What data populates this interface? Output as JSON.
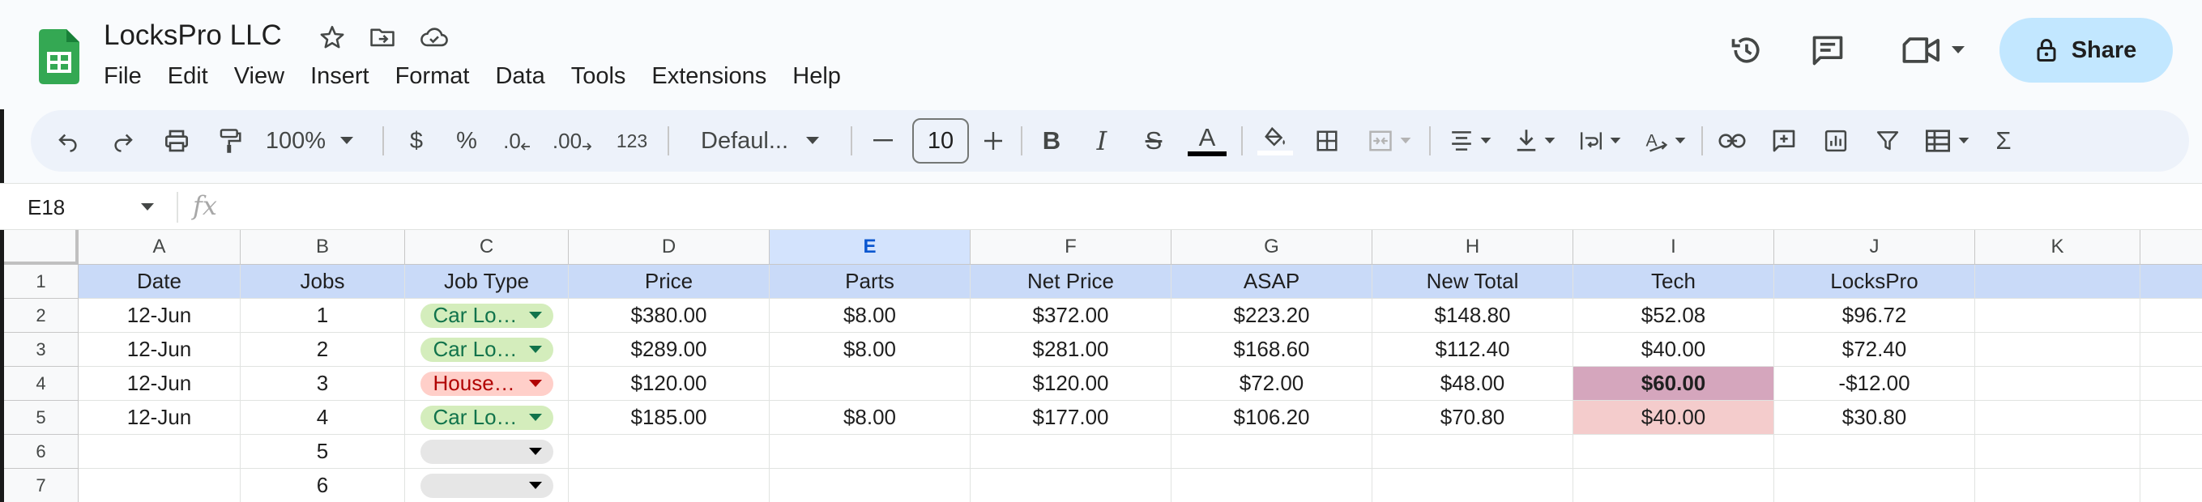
{
  "app": {
    "doc_title": "LocksPro LLC",
    "menu": [
      "File",
      "Edit",
      "View",
      "Insert",
      "Format",
      "Data",
      "Tools",
      "Extensions",
      "Help"
    ],
    "share_label": "Share"
  },
  "toolbar": {
    "zoom": "100%",
    "currency": "$",
    "percent": "%",
    "decrease_decimal": ".0",
    "increase_decimal": ".00",
    "more_formats": "123",
    "font": "Defaul...",
    "font_size": "10"
  },
  "formula_bar": {
    "cell_ref": "E18",
    "fx": "fx"
  },
  "grid": {
    "columns": [
      "A",
      "B",
      "C",
      "D",
      "E",
      "F",
      "G",
      "H",
      "I",
      "J",
      "K"
    ],
    "selected_column": "E",
    "row_numbers": [
      "1",
      "2",
      "3",
      "4",
      "5",
      "6",
      "7"
    ],
    "header_row": [
      "Date",
      "Jobs",
      "Job Type",
      "Price",
      "Parts",
      "Net Price",
      "ASAP",
      "New Total",
      "Tech",
      "LocksPro",
      ""
    ],
    "rows": [
      [
        "12-Jun",
        "1",
        "Car Lo…",
        "$380.00",
        "$8.00",
        "$372.00",
        "$223.20",
        "$148.80",
        "$52.08",
        "$96.72",
        ""
      ],
      [
        "12-Jun",
        "2",
        "Car Lo…",
        "$289.00",
        "$8.00",
        "$281.00",
        "$168.60",
        "$112.40",
        "$40.00",
        "$72.40",
        ""
      ],
      [
        "12-Jun",
        "3",
        "House…",
        "$120.00",
        "",
        "$120.00",
        "$72.00",
        "$48.00",
        "$60.00",
        "-$12.00",
        ""
      ],
      [
        "12-Jun",
        "4",
        "Car Lo…",
        "$185.00",
        "$8.00",
        "$177.00",
        "$106.20",
        "$70.80",
        "$40.00",
        "$30.80",
        ""
      ],
      [
        "",
        "5",
        "",
        "",
        "",
        "",
        "",
        "",
        "",
        "",
        ""
      ],
      [
        "",
        "6",
        "",
        "",
        "",
        "",
        "",
        "",
        "",
        "",
        ""
      ]
    ],
    "chip_colors": {
      "car": {
        "bg": "#d4edbc",
        "fg": "#11734b"
      },
      "house": {
        "bg": "#ffcfc9",
        "fg": "#b10202"
      },
      "empty": {
        "bg": "#e6e6e6",
        "fg": "#3d3d3d"
      }
    },
    "highlight_colors": {
      "tech_row4": "#d5a6bd",
      "tech_row5": "#f4cccc",
      "header_row": "#c9daf8"
    }
  }
}
